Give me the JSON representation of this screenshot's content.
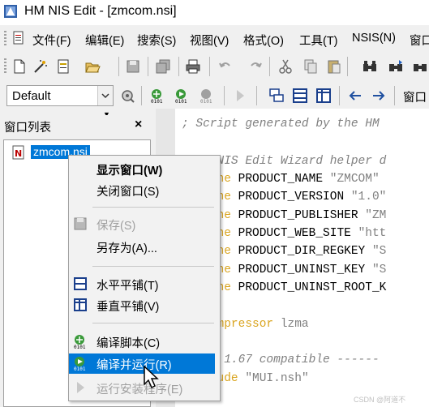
{
  "window": {
    "title": "HM NIS Edit - [zmcom.nsi]"
  },
  "menubar": {
    "items": [
      "文件(F)",
      "编辑(E)",
      "搜索(S)",
      "视图(V)",
      "格式(O)",
      "工具(T)",
      "NSIS(N)",
      "窗口"
    ]
  },
  "toolbar": {
    "combo_value": "Default",
    "window_label": "窗口"
  },
  "panel": {
    "title": "窗口列表",
    "close": "×",
    "file": "zmcom.nsi"
  },
  "editor": {
    "lines": [
      {
        "cls": "cmt",
        "text": "; Script generated by the HM"
      },
      {
        "cls": "cmt",
        "text": "; HM NIS Edit Wizard helper d"
      },
      {
        "cls": "define",
        "kw": "!define",
        "id": " PRODUCT_NAME ",
        "str": "\"ZMCOM\""
      },
      {
        "cls": "define",
        "kw": "!define",
        "id": " PRODUCT_VERSION ",
        "str": "\"1.0\""
      },
      {
        "cls": "define",
        "kw": "!define",
        "id": " PRODUCT_PUBLISHER ",
        "str": "\"ZM"
      },
      {
        "cls": "define",
        "kw": "!define",
        "id": " PRODUCT_WEB_SITE ",
        "str": "\"htt"
      },
      {
        "cls": "define",
        "kw": "!define",
        "id": " PRODUCT_DIR_REGKEY ",
        "str": "\"S"
      },
      {
        "cls": "define",
        "kw": "!define",
        "id": " PRODUCT_UNINST_KEY ",
        "str": "\"S"
      },
      {
        "cls": "define",
        "kw": "!define",
        "id": " PRODUCT_UNINST_ROOT_K",
        "str": ""
      },
      {
        "cls": "blank",
        "text": ""
      },
      {
        "cls": "comp",
        "kw": "SetCompressor",
        "id": " ",
        "str": "lzma"
      },
      {
        "cls": "blank",
        "text": ""
      },
      {
        "cls": "cmt",
        "text": "; MUI 1.67 compatible ------"
      },
      {
        "cls": "inc",
        "kw": "!include",
        "id": " ",
        "str": "\"MUI.nsh\""
      }
    ]
  },
  "context_menu": {
    "items": [
      {
        "label": "显示窗口(W)",
        "bold": true,
        "disabled": false,
        "icon": "",
        "highlight": false
      },
      {
        "label": "关闭窗口(S)",
        "bold": false,
        "disabled": false,
        "icon": "",
        "highlight": false
      },
      {
        "label": "保存(S)",
        "bold": false,
        "disabled": true,
        "icon": "floppy-disk-icon",
        "highlight": false
      },
      {
        "label": "另存为(A)...",
        "bold": false,
        "disabled": false,
        "icon": "",
        "highlight": false
      },
      {
        "label": "水平平铺(T)",
        "bold": false,
        "disabled": false,
        "icon": "tile-horizontal-icon",
        "highlight": false
      },
      {
        "label": "垂直平铺(V)",
        "bold": false,
        "disabled": false,
        "icon": "tile-vertical-icon",
        "highlight": false
      },
      {
        "label": "编译脚本(C)",
        "bold": false,
        "disabled": false,
        "icon": "compile-icon",
        "highlight": false
      },
      {
        "label": "编译并运行(R)",
        "bold": false,
        "disabled": false,
        "icon": "compile-run-icon",
        "highlight": true
      },
      {
        "label": "运行安装程序(E)",
        "bold": false,
        "disabled": true,
        "icon": "run-arrow-icon",
        "highlight": false
      }
    ]
  },
  "watermark": "CSDN @阿道不",
  "colors": {
    "highlight": "#0078d7",
    "keyword": "#daa520",
    "comment": "#808080"
  }
}
